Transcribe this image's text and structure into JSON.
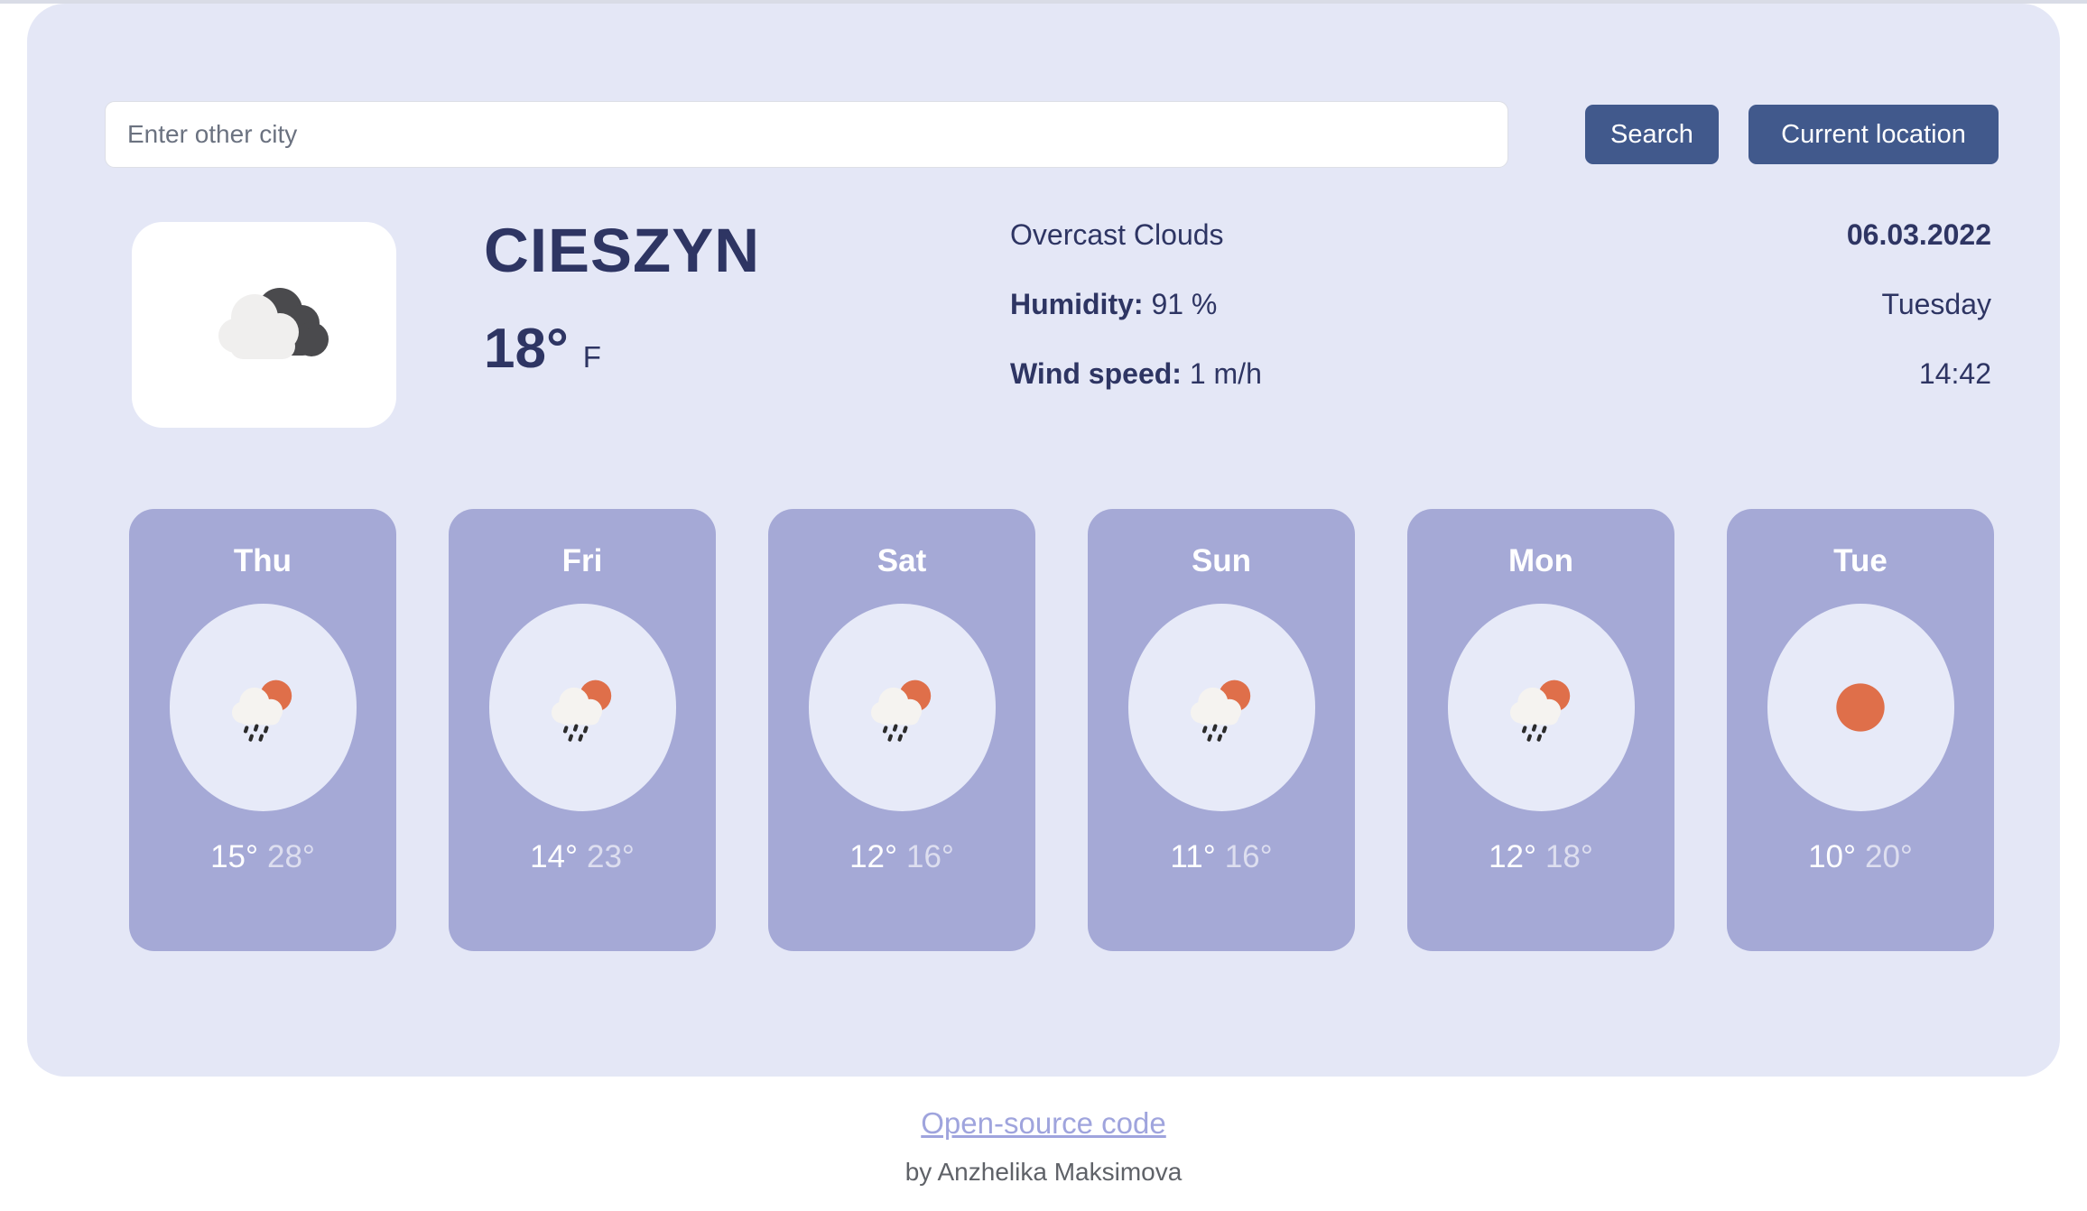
{
  "search": {
    "placeholder": "Enter other city",
    "value": "",
    "search_label": "Search",
    "location_label": "Current location"
  },
  "current": {
    "icon": "overcast-clouds-icon",
    "city": "CIESZYN",
    "temperature": "18°",
    "unit": "F",
    "description": "Overcast Clouds",
    "humidity_label": "Humidity:",
    "humidity_value": "91 %",
    "wind_label": "Wind speed:",
    "wind_value": "1 m/h",
    "date": "06.03.2022",
    "weekday": "Tuesday",
    "time": "14:42"
  },
  "forecast": [
    {
      "day": "Thu",
      "icon": "sun-behind-rain-cloud-icon",
      "low": "15°",
      "high": "28°"
    },
    {
      "day": "Fri",
      "icon": "sun-behind-rain-cloud-icon",
      "low": "14°",
      "high": "23°"
    },
    {
      "day": "Sat",
      "icon": "sun-behind-rain-cloud-icon",
      "low": "12°",
      "high": "16°"
    },
    {
      "day": "Sun",
      "icon": "sun-behind-rain-cloud-icon",
      "low": "11°",
      "high": "16°"
    },
    {
      "day": "Mon",
      "icon": "sun-behind-rain-cloud-icon",
      "low": "12°",
      "high": "18°"
    },
    {
      "day": "Tue",
      "icon": "sun-icon",
      "low": "10°",
      "high": "20°"
    }
  ],
  "footer": {
    "link_label": "Open-source code",
    "author": "by Anzhelika Maksimova"
  },
  "colors": {
    "page_background": "#ffffff",
    "panel_background": "#e4e7f6",
    "accent_button": "#41598c",
    "navy_text": "#2e3563",
    "card_purple": "#a5a9d6",
    "icon_well": "#e7eaf8",
    "sun_orange": "#df6f4a",
    "link_lavender": "#9fa4dd"
  }
}
